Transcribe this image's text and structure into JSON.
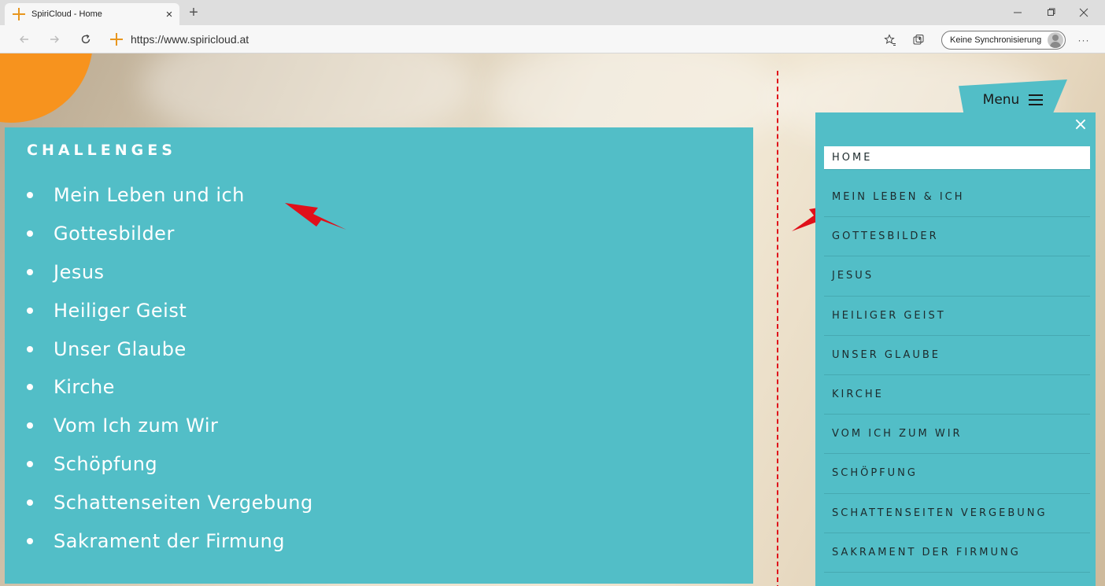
{
  "browser": {
    "tab_title": "SpiriCloud - Home",
    "tab_close": "×",
    "new_tab": "+",
    "url": "https://www.spiricloud.at",
    "sync_label": "Keine Synchronisierung",
    "more": "···"
  },
  "challenges": {
    "title": "CHALLENGES",
    "items": [
      "Mein Leben und ich",
      "Gottesbilder",
      "Jesus",
      "Heiliger Geist",
      "Unser Glaube",
      "Kirche",
      "Vom Ich zum Wir",
      "Schöpfung",
      "Schattenseiten Vergebung",
      "Sakrament der Firmung"
    ]
  },
  "menu": {
    "label": "Menu",
    "close": "×",
    "items": [
      "HOME",
      "MEIN LEBEN & ICH",
      "GOTTESBILDER",
      "JESUS",
      "HEILIGER GEIST",
      "UNSER GLAUBE",
      "KIRCHE",
      "VOM ICH ZUM WIR",
      "SCHÖPFUNG",
      "SCHATTENSEITEN VERGEBUNG",
      "SAKRAMENT DER FIRMUNG"
    ]
  },
  "colors": {
    "teal": "#52bec7",
    "orange": "#f7931e",
    "annotation_red": "#e0101a"
  }
}
